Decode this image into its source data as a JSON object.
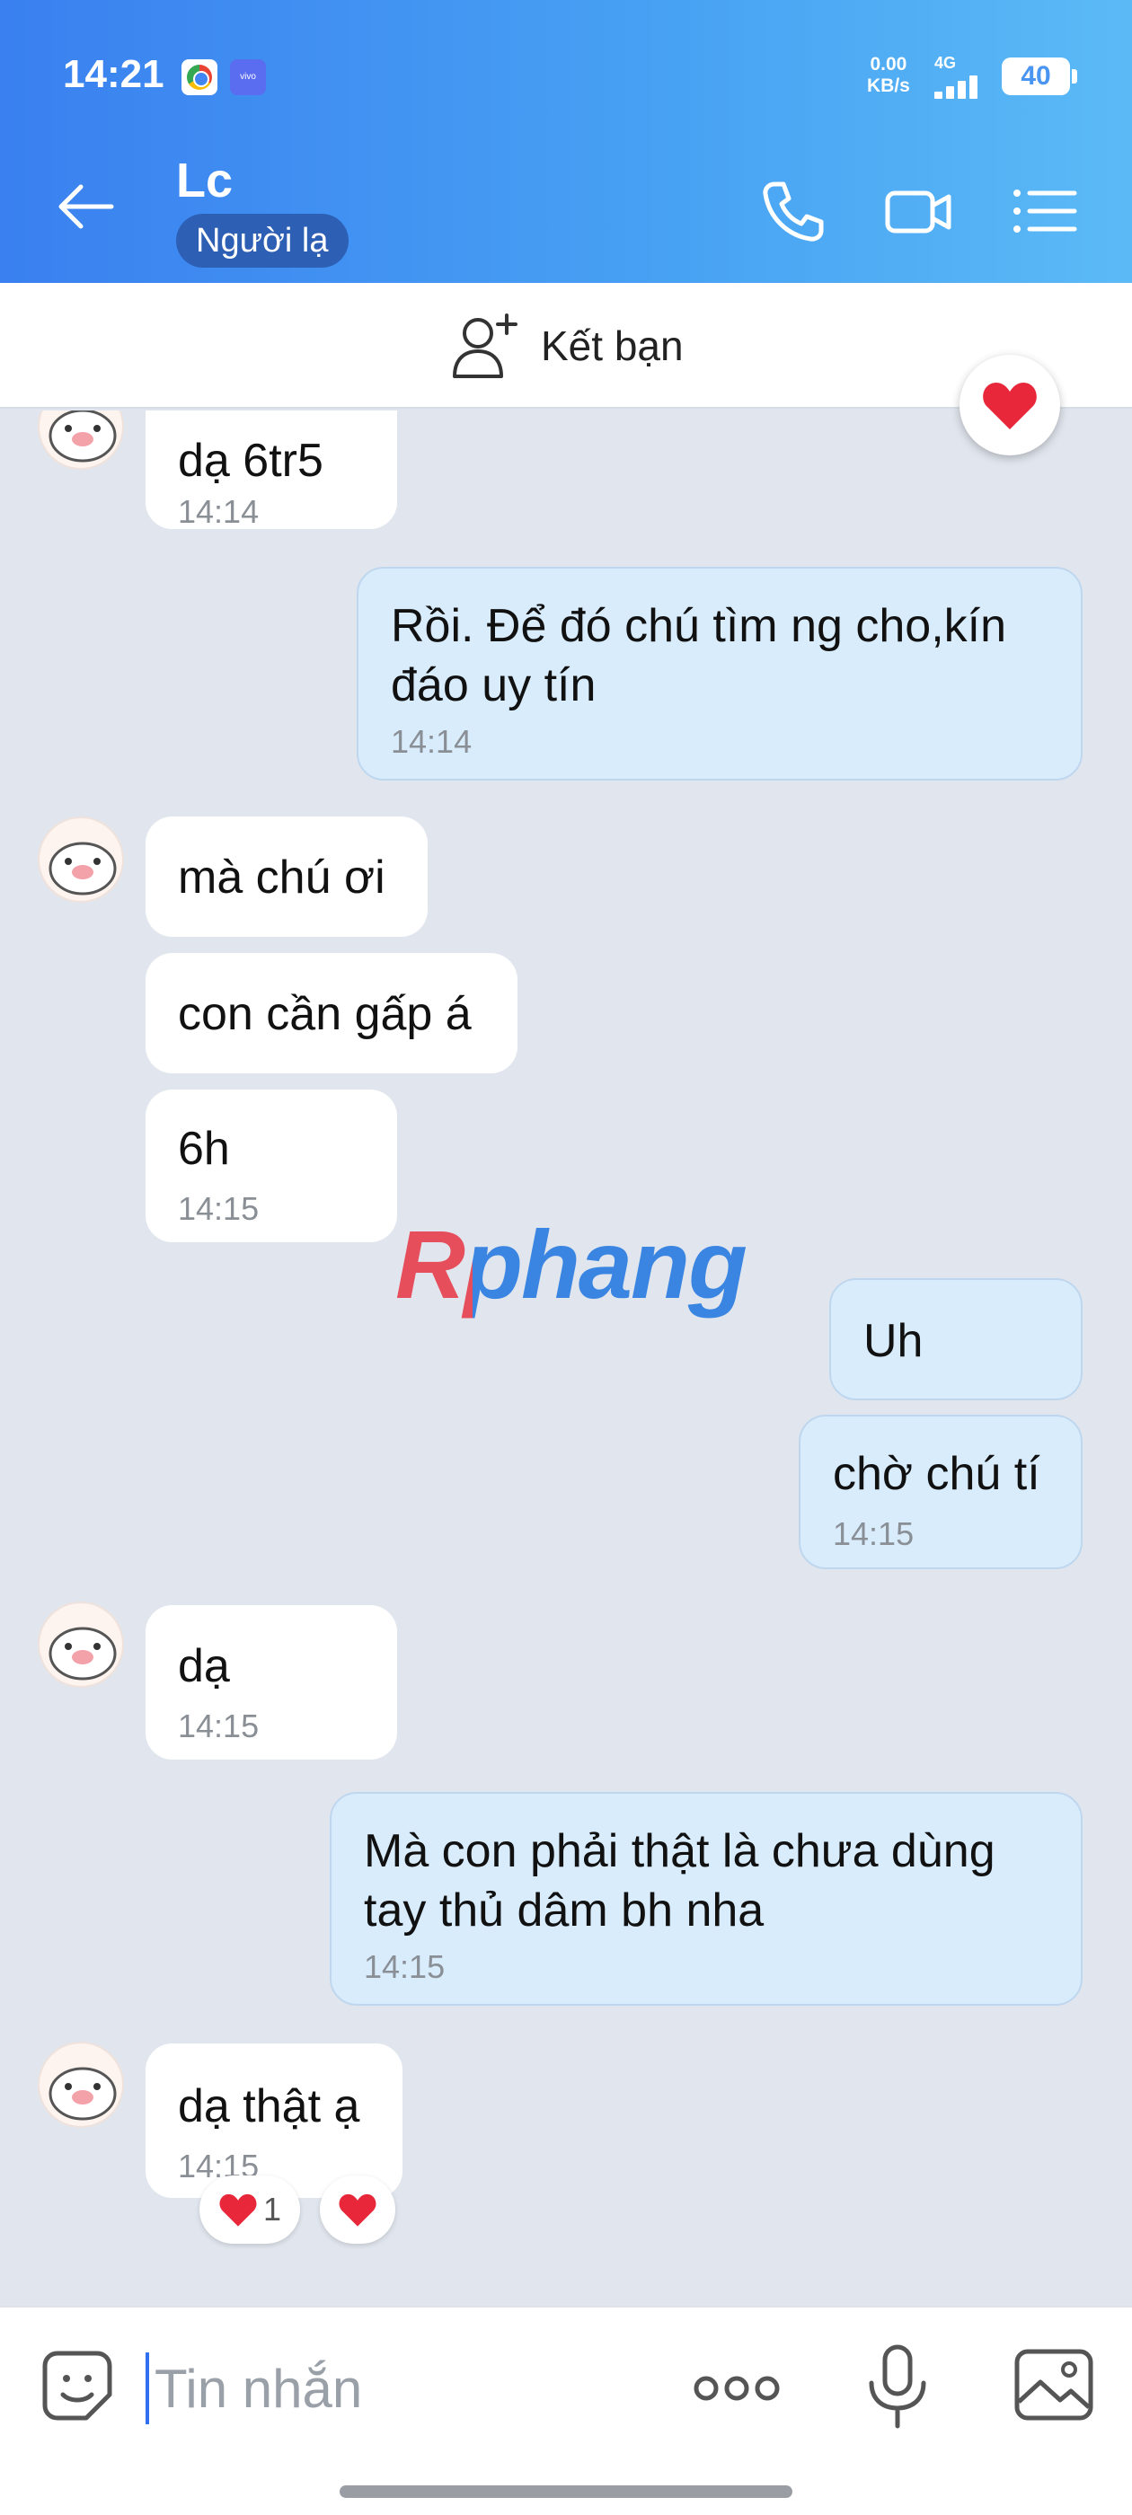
{
  "status_bar": {
    "time": "14:21",
    "vivo_label": "vivo",
    "net_speed_value": "0.00",
    "net_speed_unit": "KB/s",
    "network": "4G",
    "battery": "40"
  },
  "header": {
    "contact_name": "Lc",
    "badge": "Người lạ",
    "back_icon": "arrow-left-icon",
    "call_icon": "phone-icon",
    "video_icon": "video-camera-icon",
    "menu_icon": "menu-list-icon"
  },
  "add_friend": {
    "label": "Kết bạn",
    "icon": "add-user-icon"
  },
  "messages": [
    {
      "side": "in",
      "text": "dạ 6tr5",
      "time": "14:14"
    },
    {
      "side": "out",
      "text": "Rồi. Để đó chú tìm ng cho,kín",
      "text2": "đáo uy tín",
      "time": "14:14"
    },
    {
      "side": "in",
      "text": "mà chú ơi"
    },
    {
      "side": "in",
      "text": "con cần gấp á"
    },
    {
      "side": "in",
      "text": "6h",
      "time": "14:15"
    },
    {
      "side": "out",
      "text": "Uh"
    },
    {
      "side": "out",
      "text": "chờ chú tí",
      "time": "14:15"
    },
    {
      "side": "in",
      "text": "dạ",
      "time": "14:15"
    },
    {
      "side": "out",
      "text": "Mà con phải thật là chưa dùng",
      "text2": "tay thủ dâm bh nha",
      "time": "14:15"
    },
    {
      "side": "in",
      "text": "dạ thật ạ",
      "time": "14:15"
    }
  ],
  "reactions": {
    "count": "1",
    "heart_color": "#e8283a"
  },
  "watermark": "Rphang",
  "input": {
    "placeholder": "Tin nhắn",
    "value": ""
  },
  "colors": {
    "header_start": "#3a80f0",
    "header_end": "#5bbaf6",
    "badge_bg": "#2d5fb4",
    "outgoing_bubble": "#d8ecfc",
    "chat_bg": "#e1e6ee"
  }
}
